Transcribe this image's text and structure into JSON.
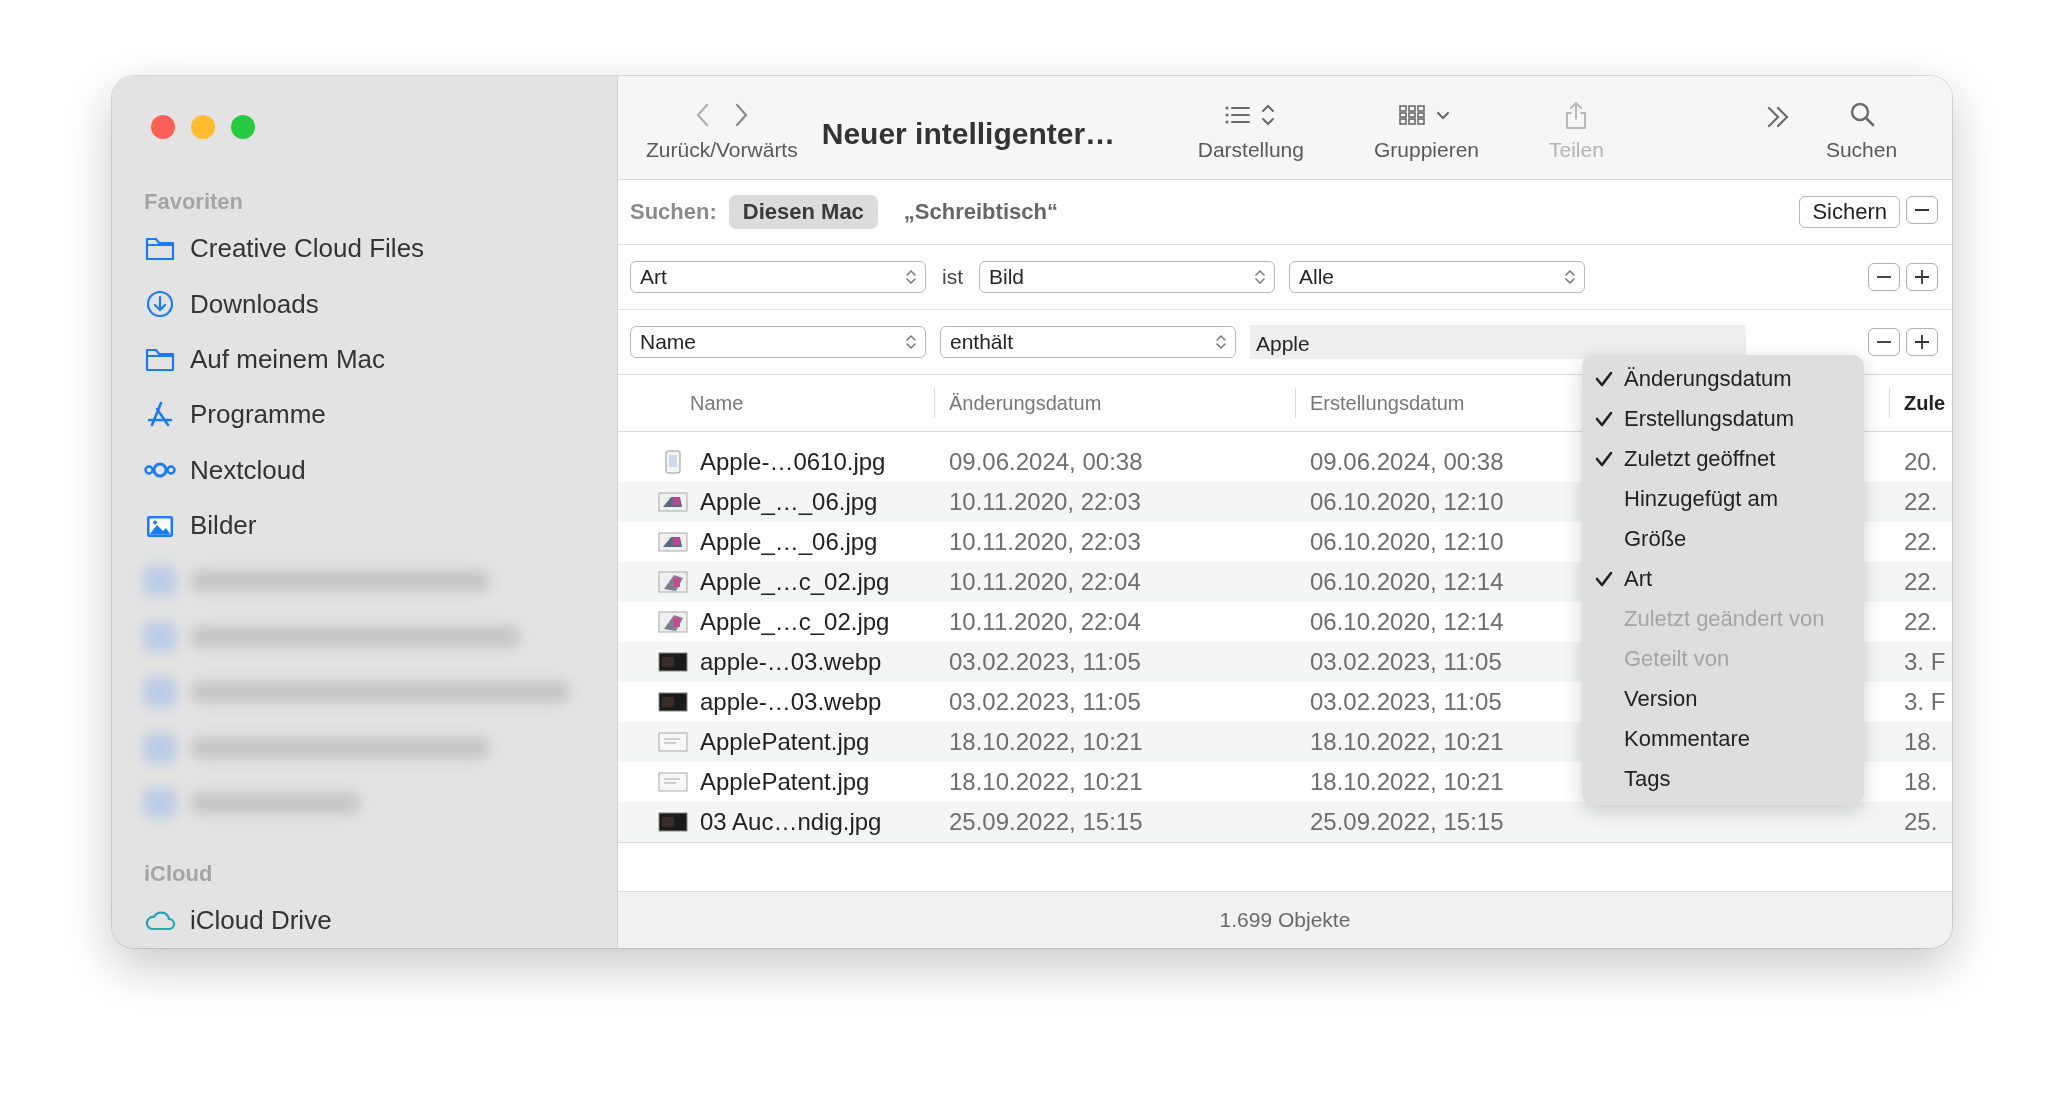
{
  "window": {
    "title": "Neuer intelligenter…"
  },
  "sidebar": {
    "sections": [
      {
        "title": "Favoriten",
        "items": [
          {
            "kind": "folder",
            "label": "Creative Cloud Files"
          },
          {
            "kind": "download",
            "label": "Downloads"
          },
          {
            "kind": "folder",
            "label": "Auf meinem Mac"
          },
          {
            "kind": "apps",
            "label": "Programme"
          },
          {
            "kind": "nextcloud",
            "label": "Nextcloud"
          },
          {
            "kind": "image",
            "label": "Bilder"
          },
          {
            "kind": "blurred"
          },
          {
            "kind": "blurred"
          },
          {
            "kind": "blurred"
          },
          {
            "kind": "blurred"
          },
          {
            "kind": "blurred"
          }
        ]
      },
      {
        "title": "iCloud",
        "items": [
          {
            "kind": "cloud",
            "label": "iCloud Drive"
          }
        ]
      }
    ]
  },
  "toolbar": {
    "nav_label": "Zurück/Vorwärts",
    "items": [
      {
        "kind": "view",
        "label": "Darstellung",
        "disabled": false
      },
      {
        "kind": "group",
        "label": "Gruppieren",
        "disabled": false
      },
      {
        "kind": "share",
        "label": "Teilen",
        "disabled": true
      },
      {
        "kind": "more"
      },
      {
        "kind": "search",
        "label": "Suchen",
        "disabled": false
      }
    ]
  },
  "search_scope": {
    "label": "Suchen:",
    "scopes": [
      {
        "label": "Diesen Mac",
        "selected": true
      },
      {
        "label": "„Schreibtisch“",
        "selected": false
      }
    ],
    "save_button": "Sichern"
  },
  "criteria": [
    {
      "controls": [
        {
          "kind": "popup",
          "value": "Art"
        },
        {
          "kind": "text",
          "value": "ist"
        },
        {
          "kind": "popup",
          "value": "Bild"
        },
        {
          "kind": "popup",
          "value": "Alle"
        }
      ]
    },
    {
      "controls": [
        {
          "kind": "popup",
          "value": "Name"
        },
        {
          "kind": "popup",
          "value": "enthält"
        },
        {
          "kind": "field",
          "value": "Apple"
        }
      ]
    }
  ],
  "table": {
    "columns": [
      "Name",
      "Änderungsdatum",
      "Erstellungsdatum",
      "Zule"
    ],
    "rows": [
      {
        "kind": "portrait",
        "name": "Apple-…0610.jpg",
        "modified": "09.06.2024, 00:38",
        "created": "09.06.2024, 00:38",
        "column_4": "20."
      },
      {
        "kind": "laptop",
        "name": "Apple_…_06.jpg",
        "modified": "10.11.2020, 22:03",
        "created": "06.10.2020, 12:10",
        "column_4": "22."
      },
      {
        "kind": "laptop",
        "name": "Apple_…_06.jpg",
        "modified": "10.11.2020, 22:03",
        "created": "06.10.2020, 12:10",
        "column_4": "22."
      },
      {
        "kind": "tablet",
        "name": "Apple_…c_02.jpg",
        "modified": "10.11.2020, 22:04",
        "created": "06.10.2020, 12:14",
        "column_4": "22."
      },
      {
        "kind": "tablet",
        "name": "Apple_…c_02.jpg",
        "modified": "10.11.2020, 22:04",
        "created": "06.10.2020, 12:14",
        "column_4": "22."
      },
      {
        "kind": "dark",
        "name": "apple-…03.webp",
        "modified": "03.02.2023, 11:05",
        "created": "03.02.2023, 11:05",
        "column_4": "3. F"
      },
      {
        "kind": "dark",
        "name": "apple-…03.webp",
        "modified": "03.02.2023, 11:05",
        "created": "03.02.2023, 11:05",
        "column_4": "3. F"
      },
      {
        "kind": "document",
        "name": "ApplePatent.jpg",
        "modified": "18.10.2022, 10:21",
        "created": "18.10.2022, 10:21",
        "column_4": "18."
      },
      {
        "kind": "document",
        "name": "ApplePatent.jpg",
        "modified": "18.10.2022, 10:21",
        "created": "18.10.2022, 10:21",
        "column_4": "18."
      },
      {
        "kind": "dark",
        "name": "03 Auc…ndig.jpg",
        "modified": "25.09.2022, 15:15",
        "created": "25.09.2022, 15:15",
        "column_4": "25."
      }
    ]
  },
  "column_menu": {
    "items": [
      {
        "label": "Änderungsdatum",
        "checked": true,
        "disabled": false
      },
      {
        "label": "Erstellungsdatum",
        "checked": true,
        "disabled": false
      },
      {
        "label": "Zuletzt geöffnet",
        "checked": true,
        "disabled": false
      },
      {
        "label": "Hinzugefügt am",
        "checked": false,
        "disabled": false
      },
      {
        "label": "Größe",
        "checked": false,
        "disabled": false
      },
      {
        "label": "Art",
        "checked": true,
        "disabled": false
      },
      {
        "label": "Zuletzt geändert von",
        "checked": false,
        "disabled": true
      },
      {
        "label": "Geteilt von",
        "checked": false,
        "disabled": true
      },
      {
        "label": "Version",
        "checked": false,
        "disabled": false
      },
      {
        "label": "Kommentare",
        "checked": false,
        "disabled": false
      },
      {
        "label": "Tags",
        "checked": false,
        "disabled": false
      }
    ]
  },
  "status_bar": "1.699 Objekte"
}
